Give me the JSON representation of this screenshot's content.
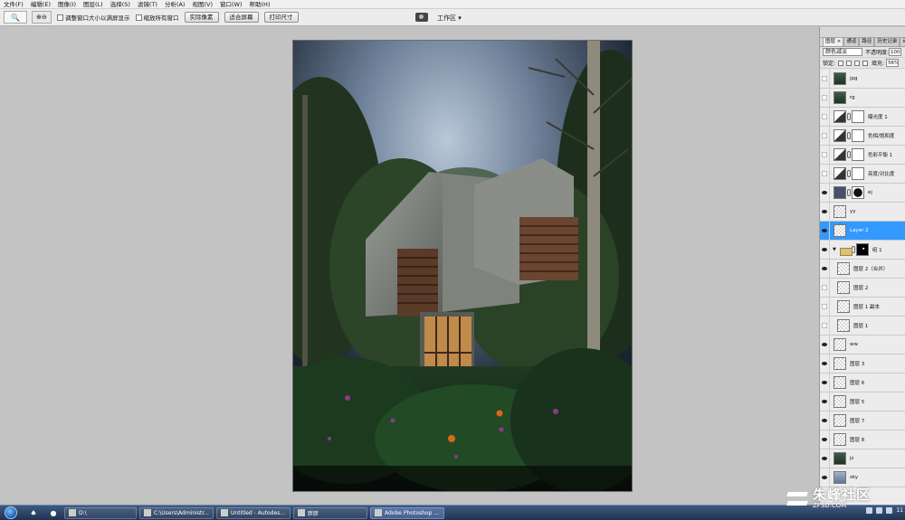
{
  "menubar": {
    "items": [
      "文件(F)",
      "编辑(E)",
      "图像(I)",
      "图层(L)",
      "选择(S)",
      "滤镜(T)",
      "分析(A)",
      "视图(V)",
      "窗口(W)",
      "帮助(H)"
    ]
  },
  "options": {
    "tool_icon": "zoom-tool-icon",
    "tool_glyph": "🔍",
    "resize_label": "调整窗口大小以满屏显示",
    "zoom_all_label": "缩放所有窗口",
    "actual_pixels": "实际像素",
    "fit_screen": "适合屏幕",
    "print_size": "打印尺寸",
    "workspace": "工作区 ▾"
  },
  "panel": {
    "tabs": [
      "图层 ×",
      "通道",
      "路径",
      "历史记录",
      "动作"
    ],
    "blend_mode": "颜色减淡",
    "opacity_label": "不透明度:",
    "opacity_value": "100",
    "lock_label": "锁定:",
    "fill_label": "填充:",
    "fill_value": "56%"
  },
  "layers": [
    {
      "name": "jpg",
      "visible": false,
      "thumb": "photo"
    },
    {
      "name": "rg",
      "visible": false,
      "thumb": "photo"
    },
    {
      "name": "曝光度 1",
      "visible": false,
      "thumb": "adj",
      "mask": true
    },
    {
      "name": "色相/饱和度",
      "visible": false,
      "thumb": "adj",
      "mask": true
    },
    {
      "name": "色彩平衡 1",
      "visible": false,
      "thumb": "adj",
      "mask": true
    },
    {
      "name": "亮度/对比度",
      "visible": false,
      "thumb": "adj",
      "mask": true
    },
    {
      "name": "ej",
      "visible": true,
      "thumb": "dark",
      "mask": "circle"
    },
    {
      "name": "yy",
      "visible": true,
      "thumb": "checker"
    },
    {
      "name": "Layer 2",
      "visible": true,
      "thumb": "checker",
      "selected": true
    },
    {
      "name": "组 1",
      "visible": true,
      "thumb": "folder",
      "mask": "black"
    },
    {
      "name": "图层 2（合并）",
      "visible": true,
      "thumb": "checker",
      "indent": true
    },
    {
      "name": "图层 2",
      "visible": false,
      "thumb": "checker",
      "indent": true
    },
    {
      "name": "图层 1 副本",
      "visible": false,
      "thumb": "checker",
      "indent": true
    },
    {
      "name": "图层 1",
      "visible": false,
      "thumb": "checker",
      "indent": true
    },
    {
      "name": "ww",
      "visible": true,
      "thumb": "checker"
    },
    {
      "name": "图层 3",
      "visible": true,
      "thumb": "checker"
    },
    {
      "name": "图层 6",
      "visible": true,
      "thumb": "checker"
    },
    {
      "name": "图层 5",
      "visible": true,
      "thumb": "checker"
    },
    {
      "name": "图层 7",
      "visible": true,
      "thumb": "checker"
    },
    {
      "name": "图层 8",
      "visible": true,
      "thumb": "checker"
    },
    {
      "name": "jz",
      "visible": true,
      "thumb": "photo"
    },
    {
      "name": "sky",
      "visible": true,
      "thumb": "sky"
    }
  ],
  "taskbar": {
    "items": [
      {
        "label": "D:\\",
        "active": false
      },
      {
        "label": "C:\\Users\\Administr...",
        "active": false
      },
      {
        "label": "Untitled - Autodes...",
        "active": false
      },
      {
        "label": "胖胖",
        "active": false
      },
      {
        "label": "Adobe Photoshop ...",
        "active": true
      }
    ],
    "clock": "11"
  },
  "watermark": {
    "cn": "朱峰社区",
    "url": "ZF3D.COM"
  },
  "colors": {
    "selection": "#3399ff",
    "taskbar": "#1f3252"
  }
}
